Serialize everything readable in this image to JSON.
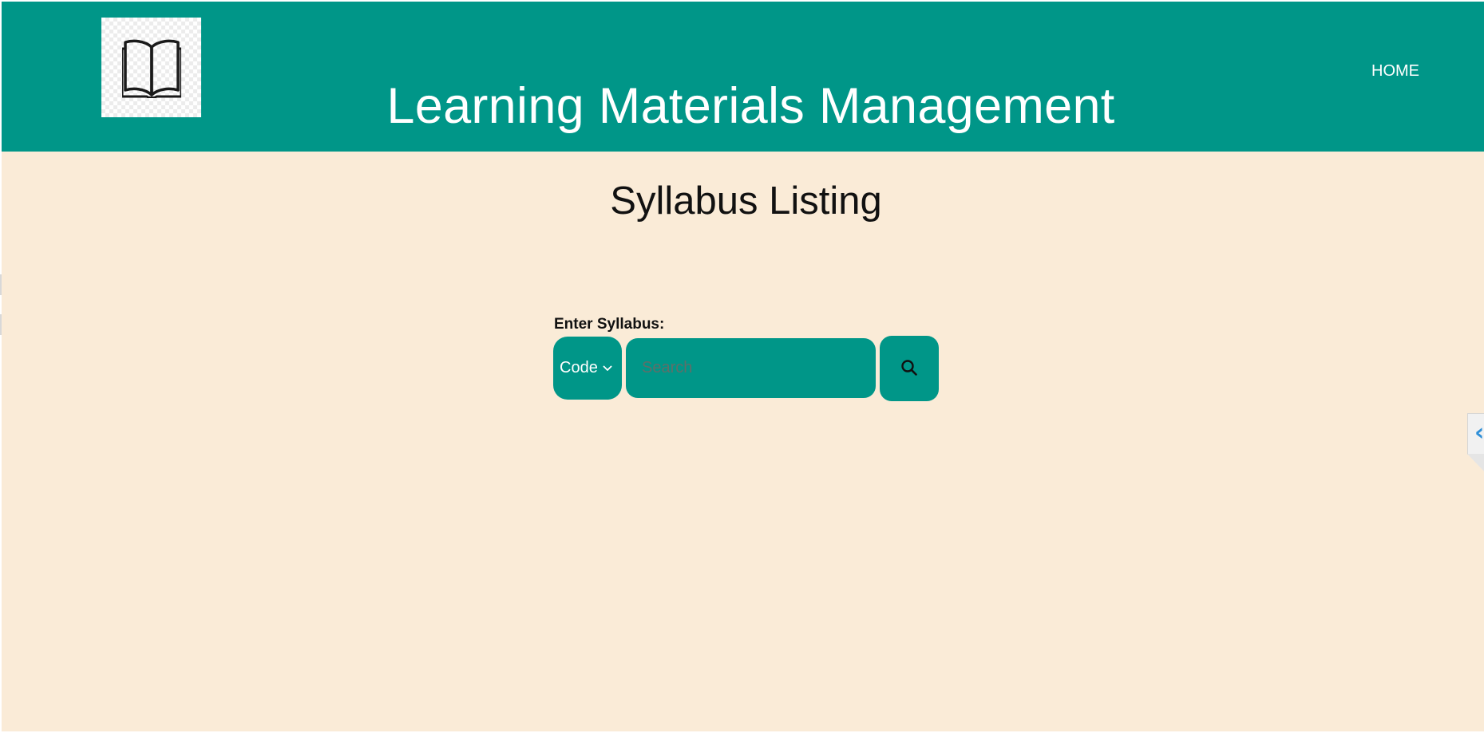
{
  "header": {
    "title": "Learning Materials Management",
    "logo_icon": "open-book-icon",
    "nav": {
      "home_label": "HOME"
    },
    "background_color": "#009688"
  },
  "main": {
    "page_title": "Syllabus Listing",
    "background_color": "#faebd7",
    "search": {
      "label": "Enter Syllabus:",
      "type_select": {
        "selected": "Code",
        "icon": "chevron-down-icon"
      },
      "input": {
        "value": "",
        "placeholder": "Search"
      },
      "button_icon": "search-icon"
    }
  },
  "side_panel_tab": {
    "icon": "chevron-left-icon",
    "glyph": "‹"
  }
}
